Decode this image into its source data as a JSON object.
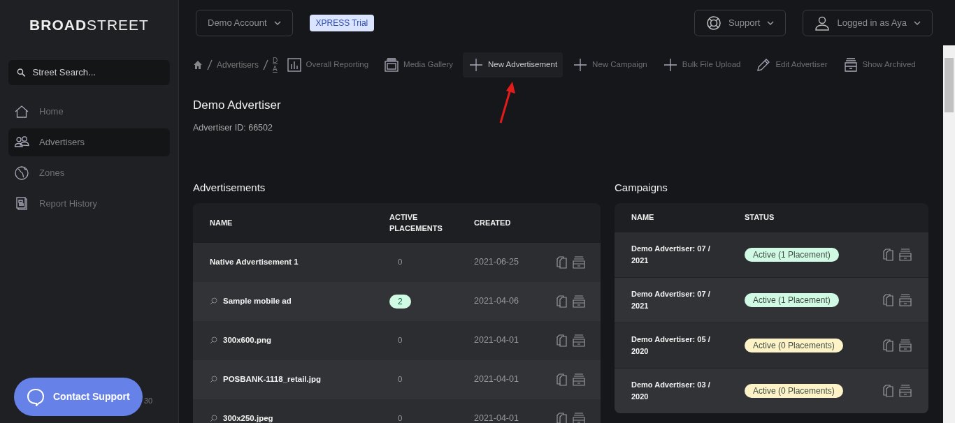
{
  "brand": {
    "bold": "BROAD",
    "light": "STREET"
  },
  "search": {
    "placeholder": "Street Search..."
  },
  "sidebar": {
    "items": [
      {
        "label": "Home",
        "kind": "home",
        "selected": false
      },
      {
        "label": "Advertisers",
        "kind": "people",
        "selected": true
      },
      {
        "label": "Zones",
        "kind": "globe",
        "selected": false
      },
      {
        "label": "Report History",
        "kind": "report",
        "selected": false
      }
    ]
  },
  "version_text": "30",
  "contact_button": "Contact Support",
  "topbar": {
    "account": "Demo Account",
    "trial_badge": "XPRESS Trial",
    "support": "Support",
    "user": "Logged in as Aya"
  },
  "breadcrumb": [
    "Advertisers",
    "D A"
  ],
  "toolbar": [
    {
      "label": "Overall Reporting",
      "kind": "chart",
      "selected": false
    },
    {
      "label": "Media Gallery",
      "kind": "gallery",
      "selected": false
    },
    {
      "label": "New Advertisement",
      "kind": "plus",
      "selected": true
    },
    {
      "label": "New Campaign",
      "kind": "plus",
      "selected": false
    },
    {
      "label": "Bulk File Upload",
      "kind": "plus",
      "selected": false
    },
    {
      "label": "Edit Advertiser",
      "kind": "pencil",
      "selected": false
    },
    {
      "label": "Show Archived",
      "kind": "tray",
      "selected": false
    }
  ],
  "advertiser": {
    "name": "Demo Advertiser",
    "id_text": "Advertiser ID: 66502"
  },
  "advertisements": {
    "title": "Advertisements",
    "columns": [
      "NAME",
      "ACTIVE PLACEMENTS",
      "CREATED"
    ],
    "rows": [
      {
        "name": "Native Advertisement 1",
        "preview": false,
        "placements": "0",
        "placements_active": false,
        "created": "2021-06-25"
      },
      {
        "name": "Sample mobile ad",
        "preview": true,
        "placements": "2",
        "placements_active": true,
        "created": "2021-04-06"
      },
      {
        "name": "300x600.png",
        "preview": true,
        "placements": "0",
        "placements_active": false,
        "created": "2021-04-01"
      },
      {
        "name": "POSBANK-1118_retail.jpg",
        "preview": true,
        "placements": "0",
        "placements_active": false,
        "created": "2021-04-01"
      },
      {
        "name": "300x250.jpeg",
        "preview": true,
        "placements": "0",
        "placements_active": false,
        "created": "2021-04-01"
      }
    ]
  },
  "campaigns": {
    "title": "Campaigns",
    "columns": [
      "NAME",
      "STATUS"
    ],
    "rows": [
      {
        "name": "Demo Advertiser: 07 / 2021",
        "status": "Active (1 Placement)",
        "color": "#d1fae5"
      },
      {
        "name": "Demo Advertiser: 07 / 2021",
        "status": "Active (1 Placement)",
        "color": "#d1fae5"
      },
      {
        "name": "Demo Advertiser: 05 / 2020",
        "status": "Active (0 Placements)",
        "color": "#fef3c7"
      },
      {
        "name": "Demo Advertiser: 03 / 2020",
        "status": "Active (0 Placements)",
        "color": "#fef3c7"
      }
    ]
  }
}
